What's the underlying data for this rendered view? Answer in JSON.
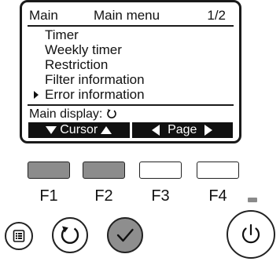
{
  "screen": {
    "header": {
      "left": "Main",
      "center": "Main menu",
      "right": "1/2"
    },
    "menu_items": [
      {
        "label": "Timer",
        "selected": false
      },
      {
        "label": "Weekly timer",
        "selected": false
      },
      {
        "label": "Restriction",
        "selected": false
      },
      {
        "label": "Filter information",
        "selected": false
      },
      {
        "label": "Error information",
        "selected": true
      }
    ],
    "main_display_label": "Main display:",
    "main_display_icon": "return-icon",
    "soft_keys": {
      "cursor_label": "Cursor",
      "page_label": "Page"
    }
  },
  "function_keys": [
    {
      "label": "F1",
      "shade": "dark"
    },
    {
      "label": "F2",
      "shade": "dark"
    },
    {
      "label": "F3",
      "shade": "light"
    },
    {
      "label": "F4",
      "shade": "light"
    }
  ],
  "buttons": {
    "menu": "menu-list-icon",
    "return": "return-icon",
    "select": "check-icon",
    "power": "power-icon"
  },
  "colors": {
    "outline": "#1a1a1a",
    "dark_key": "#8c8c8c",
    "select_button": "#8e8e8e",
    "indicator_led": "#8a8a8a"
  }
}
